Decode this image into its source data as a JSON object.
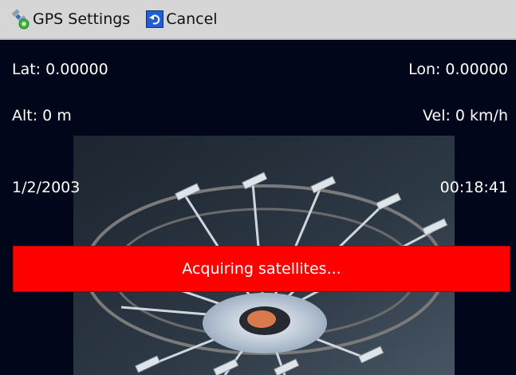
{
  "toolbar": {
    "gps_settings_label": "GPS Settings",
    "cancel_label": "Cancel",
    "gps_icon": "satellite-gps-icon",
    "cancel_icon": "undo-arrow-icon"
  },
  "readouts": {
    "lat": "Lat: 0.00000",
    "lon": "Lon: 0.00000",
    "alt": "Alt: 0 m",
    "vel": "Vel: 0 km/h",
    "date": "1/2/2003",
    "time": "00:18:41"
  },
  "status": {
    "message": "Acquiring satellites..."
  },
  "colors": {
    "background": "#02061a",
    "toolbar": "#d6d6d6",
    "banner": "#ff0000",
    "text": "#ffffff"
  }
}
